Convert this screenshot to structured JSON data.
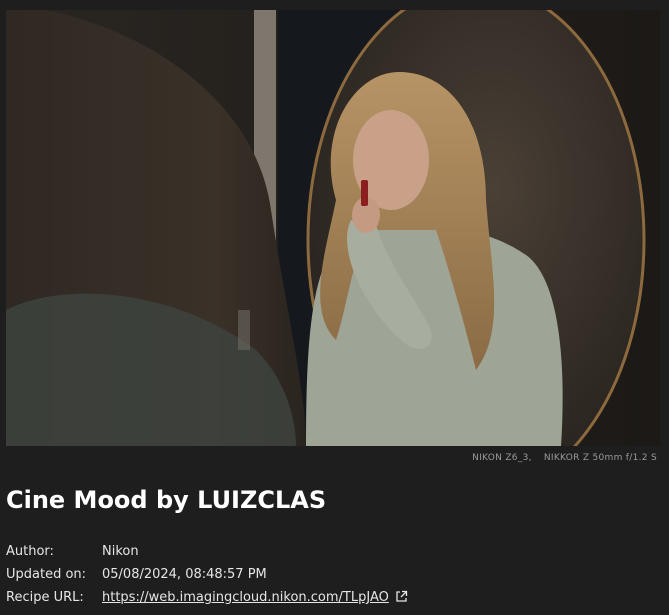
{
  "photo": {
    "description_icon": "portrait-photo",
    "camera_body": "NIKON Z6_3,",
    "lens": "NIKKOR Z 50mm f/1.2 S"
  },
  "recipe": {
    "title": "Cine Mood by LUIZCLAS",
    "author_label": "Author:",
    "author_value": "Nikon",
    "updated_label": "Updated on:",
    "updated_value": "05/08/2024, 08:48:57 PM",
    "url_label": "Recipe URL:",
    "url_value": "https://web.imagingcloud.nikon.com/TLpJAO",
    "url_icon": "external-link-icon"
  },
  "colors": {
    "background": "#1e1e1e",
    "text": "#e6e6e6",
    "title": "#ffffff",
    "muted": "#9a9a9a"
  }
}
